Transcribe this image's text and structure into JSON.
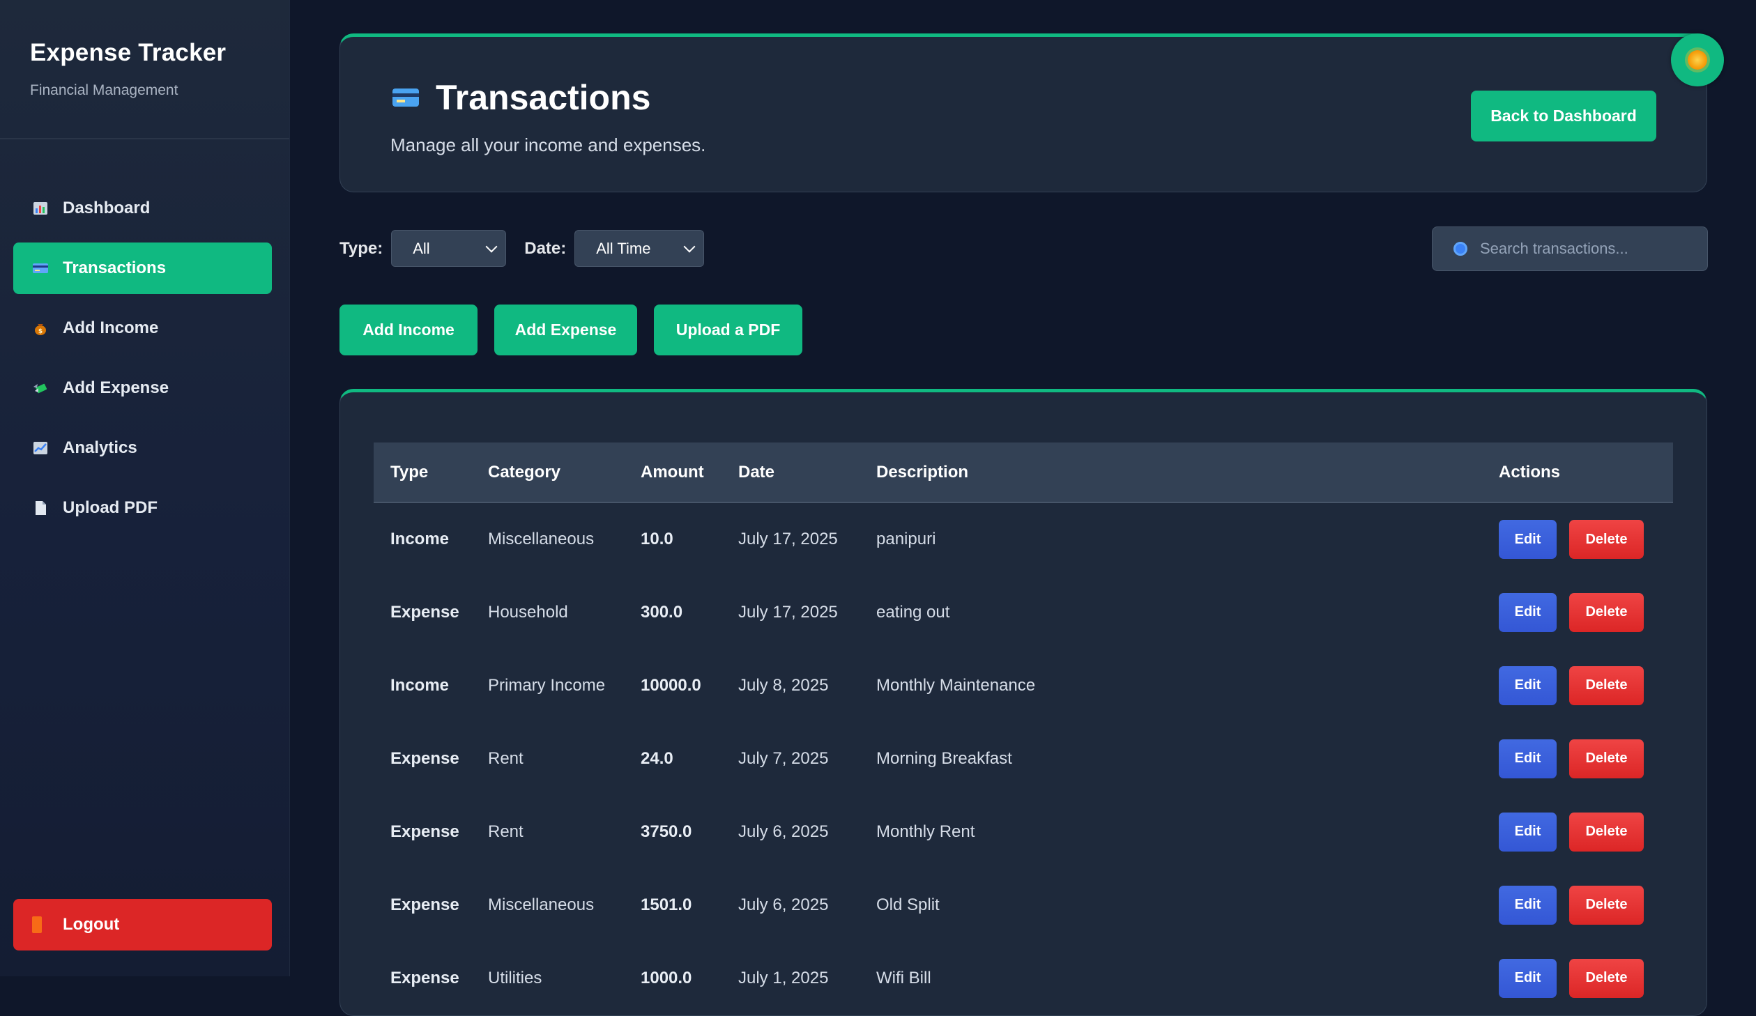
{
  "sidebar": {
    "brand_title": "Expense Tracker",
    "brand_subtitle": "Financial Management",
    "items": [
      {
        "label": "Dashboard",
        "icon": "bar-chart-icon",
        "active": false
      },
      {
        "label": "Transactions",
        "icon": "credit-card-icon",
        "active": true
      },
      {
        "label": "Add Income",
        "icon": "money-bag-icon",
        "active": false
      },
      {
        "label": "Add Expense",
        "icon": "money-wings-icon",
        "active": false
      },
      {
        "label": "Analytics",
        "icon": "chart-up-icon",
        "active": false
      },
      {
        "label": "Upload PDF",
        "icon": "document-icon",
        "active": false
      }
    ],
    "logout_label": "Logout"
  },
  "header": {
    "title": "Transactions",
    "subtitle": "Manage all your income and expenses.",
    "back_button": "Back to Dashboard"
  },
  "filters": {
    "type_label": "Type:",
    "type_value": "All",
    "date_label": "Date:",
    "date_value": "All Time",
    "search_placeholder": "Search transactions..."
  },
  "buttons": {
    "add_income": "Add Income",
    "add_expense": "Add Expense",
    "upload_pdf": "Upload a PDF"
  },
  "table": {
    "headers": [
      "Type",
      "Category",
      "Amount",
      "Date",
      "Description",
      "Actions"
    ],
    "edit_label": "Edit",
    "delete_label": "Delete",
    "rows": [
      {
        "type": "Income",
        "category": "Miscellaneous",
        "amount": "10.0",
        "date": "July 17, 2025",
        "description": "panipuri"
      },
      {
        "type": "Expense",
        "category": "Household",
        "amount": "300.0",
        "date": "July 17, 2025",
        "description": "eating out"
      },
      {
        "type": "Income",
        "category": "Primary Income",
        "amount": "10000.0",
        "date": "July 8, 2025",
        "description": "Monthly Maintenance"
      },
      {
        "type": "Expense",
        "category": "Rent",
        "amount": "24.0",
        "date": "July 7, 2025",
        "description": "Morning Breakfast"
      },
      {
        "type": "Expense",
        "category": "Rent",
        "amount": "3750.0",
        "date": "July 6, 2025",
        "description": "Monthly Rent"
      },
      {
        "type": "Expense",
        "category": "Miscellaneous",
        "amount": "1501.0",
        "date": "July 6, 2025",
        "description": "Old Split"
      },
      {
        "type": "Expense",
        "category": "Utilities",
        "amount": "1000.0",
        "date": "July 1, 2025",
        "description": "Wifi Bill"
      }
    ]
  },
  "colors": {
    "accent": "#10b981",
    "danger": "#dc2626",
    "edit": "#3b5bdb",
    "background": "#0f172a",
    "card": "#1e293b"
  }
}
